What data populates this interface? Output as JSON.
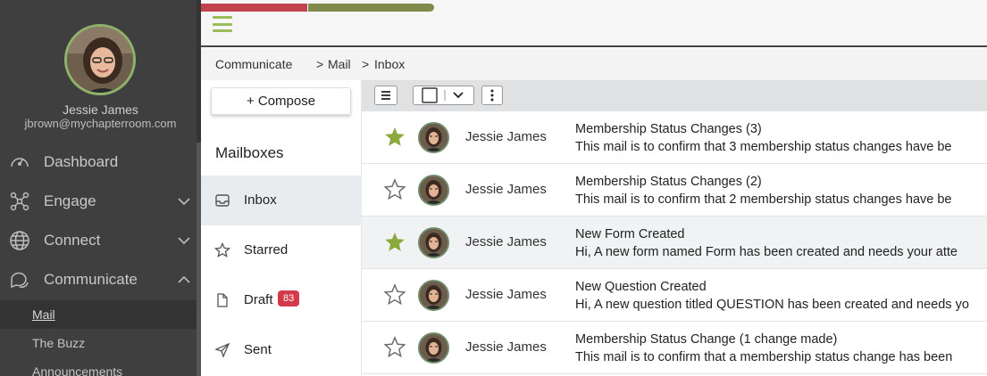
{
  "user": {
    "name": "Jessie James",
    "email": "jbrown@mychapterroom.com"
  },
  "nav": {
    "dashboard": "Dashboard",
    "engage": "Engage",
    "connect": "Connect",
    "communicate": "Communicate",
    "sub_items": [
      "Mail",
      "The Buzz",
      "Announcements"
    ]
  },
  "breadcrumb": [
    "Communicate",
    "Mail",
    "Inbox"
  ],
  "compose_label": "+ Compose",
  "mailboxes_title": "Mailboxes",
  "mailboxes": [
    {
      "label": "Inbox",
      "icon": "inbox-icon"
    },
    {
      "label": "Starred",
      "icon": "star-outline-icon"
    },
    {
      "label": "Draft",
      "icon": "document-icon",
      "badge": "83"
    },
    {
      "label": "Sent",
      "icon": "paper-plane-icon"
    }
  ],
  "colors": {
    "accent": "#9abd5a",
    "badge": "#d23a4a",
    "sidebar": "#3f3f3f",
    "star_filled": "#8aaa3e"
  },
  "mails": [
    {
      "starred": true,
      "sender": "Jessie James",
      "subject": "Membership Status Changes (3)",
      "preview": "This mail is to confirm that 3 membership status changes have be"
    },
    {
      "starred": false,
      "sender": "Jessie James",
      "subject": "Membership Status Changes (2)",
      "preview": "This mail is to confirm that 2 membership status changes have be"
    },
    {
      "starred": true,
      "sender": "Jessie James",
      "subject": "New Form Created",
      "preview": "Hi, A new form named Form has been created and needs your atte"
    },
    {
      "starred": false,
      "sender": "Jessie James",
      "subject": "New Question Created",
      "preview": "Hi, A new question titled QUESTION has been created and needs yo"
    },
    {
      "starred": false,
      "sender": "Jessie James",
      "subject": "Membership Status Change (1 change made)",
      "preview": "This mail is to confirm that a membership status change has been"
    }
  ]
}
